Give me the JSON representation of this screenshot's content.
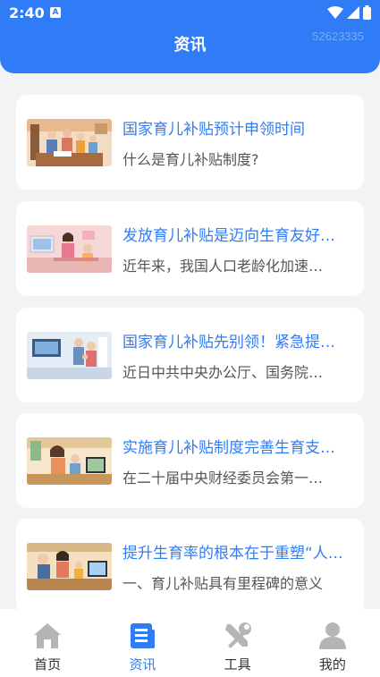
{
  "status_bar": {
    "time": "2:40",
    "app_badge": "A"
  },
  "header": {
    "title": "资讯",
    "watermark": "52623335"
  },
  "articles": [
    {
      "title": "国家育儿补贴预计申领时间",
      "subtitle": "什么是育儿补贴制度?"
    },
    {
      "title": "发放育儿补贴是迈向生育友好…",
      "subtitle": "近年来，我国人口老龄化加速…"
    },
    {
      "title": "国家育儿补贴先别领！紧急提…",
      "subtitle": "近日中共中央办公厅、国务院…"
    },
    {
      "title": "实施育儿补贴制度完善生育支…",
      "subtitle": "在二十届中央财经委员会第一…"
    },
    {
      "title": "提升生育率的根本在于重塑“人…",
      "subtitle": "一、育儿补贴具有里程碑的意义"
    }
  ],
  "tabbar": {
    "active": "资讯",
    "tabs": [
      {
        "label": "首页",
        "icon": "home-icon"
      },
      {
        "label": "资讯",
        "icon": "news-icon"
      },
      {
        "label": "工具",
        "icon": "tools-icon"
      },
      {
        "label": "我的",
        "icon": "user-icon"
      }
    ]
  },
  "colors": {
    "accent": "#2f7cf6",
    "background": "#f2f3f5",
    "inactive_icon": "#b5b5b5"
  }
}
